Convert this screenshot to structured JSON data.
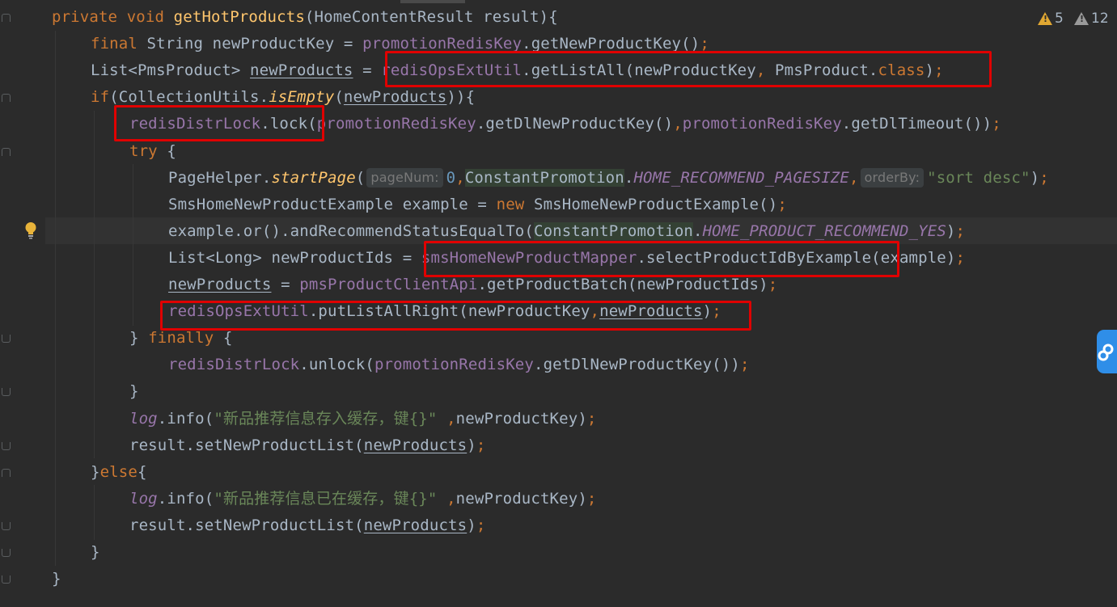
{
  "editor": {
    "warnings": {
      "yellow": "5",
      "grey": "12"
    },
    "lines": [
      [
        [
          "kw",
          "private void "
        ],
        [
          "fn",
          "getHotProducts"
        ],
        [
          "",
          "(HomeContentResult result){"
        ]
      ],
      [
        [
          "kw",
          "final "
        ],
        [
          "",
          "String newProductKey = "
        ],
        [
          "fld",
          "promotionRedisKey"
        ],
        [
          "",
          ".getNewProductKey()"
        ],
        [
          "kw",
          ";"
        ]
      ],
      [
        [
          "",
          "List<PmsProduct> "
        ],
        [
          "u",
          "newProducts"
        ],
        [
          "",
          " = "
        ],
        [
          "fld",
          "redisOpsExtUtil"
        ],
        [
          "",
          ".getListAll(newProductKey"
        ],
        [
          "kw",
          ", "
        ],
        [
          "",
          "PmsProduct."
        ],
        [
          "kw",
          "class"
        ],
        [
          "",
          ")"
        ],
        [
          "kw",
          ";"
        ]
      ],
      [
        [
          "kw",
          "if"
        ],
        [
          "",
          "(CollectionUtils."
        ],
        [
          "si",
          "isEmpty"
        ],
        [
          "",
          "("
        ],
        [
          "u",
          "newProducts"
        ],
        [
          "",
          "))"
        ],
        [
          "",
          ""
        ],
        [
          "",
          "{"
        ]
      ],
      [
        [
          "fld",
          "redisDistrLock"
        ],
        [
          "",
          ".lock("
        ],
        [
          "fld",
          "promotionRedisKey"
        ],
        [
          "",
          ".getDlNewProductKey()"
        ],
        [
          "kw",
          ","
        ],
        [
          "fld",
          "promotionRedisKey"
        ],
        [
          "",
          ".getDlTimeout())"
        ],
        [
          "kw",
          ";"
        ]
      ],
      [
        [
          "kw",
          "try "
        ],
        [
          "",
          "{"
        ]
      ],
      [
        [
          "",
          "PageHelper."
        ],
        [
          "si",
          "startPage"
        ],
        [
          "",
          "("
        ],
        [
          "hint",
          "pageNum:"
        ],
        [
          "num",
          "0"
        ],
        [
          "kw",
          ","
        ],
        [
          "hl",
          "ConstantPromotion"
        ],
        [
          "",
          "."
        ],
        [
          "st",
          "HOME_RECOMMEND_PAGESIZE"
        ],
        [
          "kw",
          ","
        ],
        [
          "hint",
          "orderBy:"
        ],
        [
          "str",
          "\"sort desc\""
        ],
        [
          "",
          ")"
        ],
        [
          "kw",
          ";"
        ]
      ],
      [
        [
          "",
          "SmsHomeNewProductExample example = "
        ],
        [
          "kw",
          "new "
        ],
        [
          "",
          "SmsHomeNewProductExample()"
        ],
        [
          "kw",
          ";"
        ]
      ],
      [
        [
          "",
          "example.or().andRecommendStatusEqualTo("
        ],
        [
          "hl",
          "ConstantPromotion"
        ],
        [
          "",
          "."
        ],
        [
          "st",
          "HOME_PRODUCT_RECOMMEND_YES"
        ],
        [
          "",
          ")"
        ],
        [
          "kw",
          ";"
        ]
      ],
      [
        [
          "",
          "List<Long> newProductIds = "
        ],
        [
          "fld",
          "smsHomeNewProductMapper"
        ],
        [
          "",
          ".selectProductIdByExample(example)"
        ],
        [
          "kw",
          ";"
        ]
      ],
      [
        [
          "u",
          "newProducts"
        ],
        [
          "",
          " = "
        ],
        [
          "fld",
          "pmsProductClientApi"
        ],
        [
          "",
          ".getProductBatch(newProductIds)"
        ],
        [
          "kw",
          ";"
        ]
      ],
      [
        [
          "fld",
          "redisOpsExtUtil"
        ],
        [
          "",
          ".putListAllRight(newProductKey"
        ],
        [
          "kw",
          ","
        ],
        [
          "u",
          "newProducts"
        ],
        [
          "",
          ")"
        ],
        [
          "kw",
          ";"
        ]
      ],
      [
        [
          "",
          "} "
        ],
        [
          "kw",
          "finally "
        ],
        [
          "",
          "{"
        ]
      ],
      [
        [
          "fld",
          "redisDistrLock"
        ],
        [
          "",
          ".unlock("
        ],
        [
          "fld",
          "promotionRedisKey"
        ],
        [
          "",
          ".getDlNewProductKey())"
        ],
        [
          "kw",
          ";"
        ]
      ],
      [
        [
          "",
          "}"
        ]
      ],
      [
        [
          "st",
          "log"
        ],
        [
          "",
          ".info("
        ],
        [
          "str",
          "\"新品推荐信息存入缓存，键{}\" "
        ],
        [
          "kw",
          ","
        ],
        [
          "",
          "newProductKey)"
        ],
        [
          "kw",
          ";"
        ]
      ],
      [
        [
          "",
          "result.setNewProductList("
        ],
        [
          "u",
          "newProducts"
        ],
        [
          "",
          ")"
        ],
        [
          "kw",
          ";"
        ]
      ],
      [
        [
          "",
          "}"
        ],
        [
          "kw",
          "else"
        ],
        [
          "",
          "{"
        ]
      ],
      [
        [
          "st",
          "log"
        ],
        [
          "",
          ".info("
        ],
        [
          "str",
          "\"新品推荐信息已在缓存，键{}\" "
        ],
        [
          "kw",
          ","
        ],
        [
          "",
          "newProductKey)"
        ],
        [
          "kw",
          ";"
        ]
      ],
      [
        [
          "",
          "result.setNewProductList("
        ],
        [
          "u",
          "newProducts"
        ],
        [
          "",
          ")"
        ],
        [
          "kw",
          ";"
        ]
      ],
      [
        [
          "",
          "}"
        ]
      ],
      [
        [
          "",
          "}"
        ]
      ]
    ]
  }
}
